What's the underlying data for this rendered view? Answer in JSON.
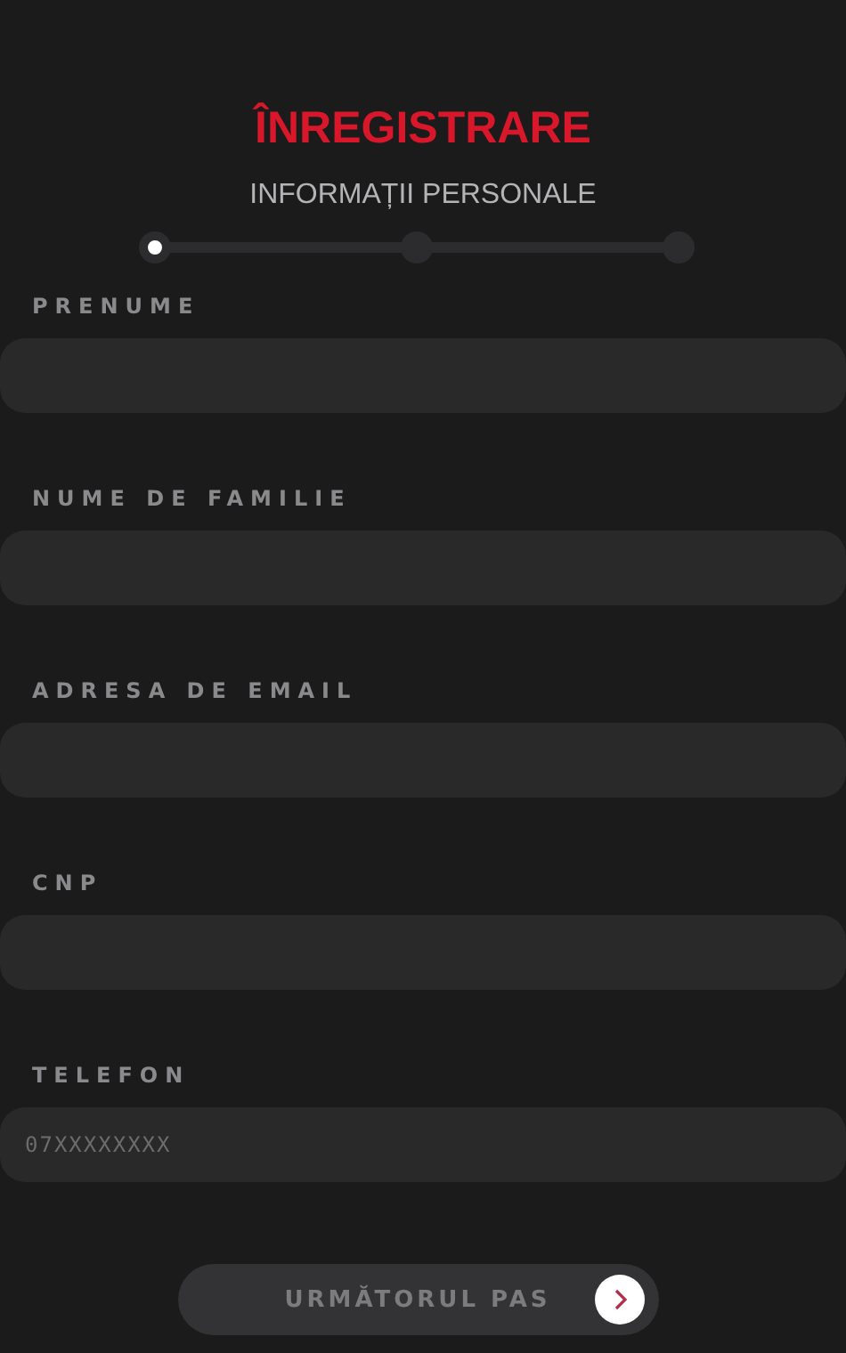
{
  "title": "ÎNREGISTRARE",
  "subtitle": "INFORMAȚII PERSONALE",
  "steps": [
    {
      "selected": true
    },
    {
      "selected": false
    },
    {
      "selected": false
    }
  ],
  "fields": [
    {
      "label": "PRENUME"
    },
    {
      "label": "NUME DE FAMILIE"
    },
    {
      "label": "ADRESA DE EMAIL"
    },
    {
      "label": "CNP"
    },
    {
      "label": "TELEFON",
      "placeholder": "07XXXXXXXX"
    }
  ],
  "next_button": {
    "label": "URMĂTORUL PAS"
  }
}
